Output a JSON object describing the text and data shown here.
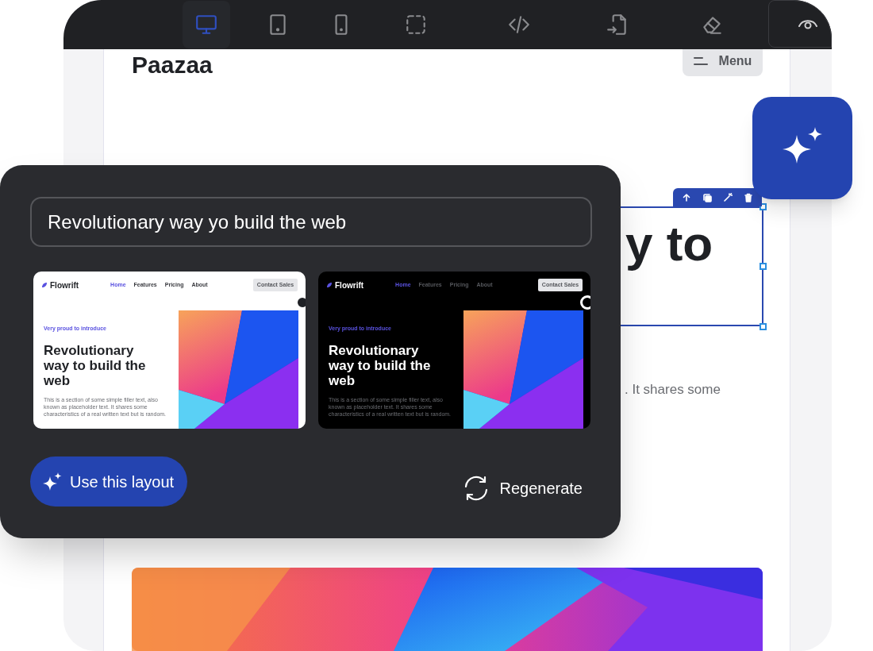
{
  "toolbar": {
    "tools": [
      {
        "kind": "desktop",
        "selected": true
      },
      {
        "kind": "tablet",
        "selected": false
      },
      {
        "kind": "phone",
        "selected": false
      },
      {
        "kind": "select",
        "selected": false
      },
      {
        "kind": "code",
        "selected": false
      },
      {
        "kind": "import",
        "selected": false
      },
      {
        "kind": "eraser",
        "selected": false
      }
    ],
    "preview": {
      "kind": "eye"
    }
  },
  "page": {
    "brand": "Paazaa",
    "menu_button": "Menu",
    "heading": "y to",
    "body": ". It shares some",
    "element_actions": [
      {
        "kind": "up"
      },
      {
        "kind": "copy"
      },
      {
        "kind": "magic"
      },
      {
        "kind": "delete"
      }
    ]
  },
  "popup": {
    "prompt": "Revolutionary way yo build the web",
    "layouts": [
      {
        "kind": "light",
        "brand": "Flowrift",
        "nav": [
          {
            "label": "Home",
            "selected": true
          },
          {
            "label": "Features",
            "selected": false
          },
          {
            "label": "Pricing",
            "selected": false
          },
          {
            "label": "About",
            "selected": false
          }
        ],
        "cta": "Contact Sales",
        "eyebrow": "Very proud to introduce",
        "heading": "Revolutionary way to build the web",
        "body": "This is a section of some simple filler text, also known as placeholder text. It shares some characteristics of a real written text but is random."
      },
      {
        "kind": "dark",
        "brand": "Flowrift",
        "nav": [
          {
            "label": "Home",
            "selected": true
          },
          {
            "label": "Features",
            "selected": false
          },
          {
            "label": "Pricing",
            "selected": false
          },
          {
            "label": "About",
            "selected": false
          }
        ],
        "cta": "Contact Sales",
        "eyebrow": "Very proud to introduce",
        "heading": "Revolutionary way to build the web",
        "body": "This is a section of some simple filler text, also known as placeholder text. It shares some characteristics of a real written text but is random."
      }
    ],
    "use_button": "Use this layout",
    "regenerate_button": "Regenerate"
  }
}
